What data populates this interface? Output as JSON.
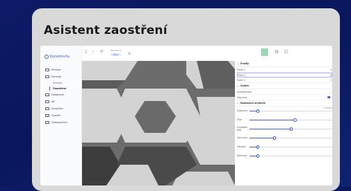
{
  "card": {
    "title": "Asistent zaostření"
  },
  "app": {
    "brand": "Konektivita",
    "sidebar": {
      "items": [
        {
          "label": "Přehled",
          "icon": "monitor-icon"
        },
        {
          "label": "Pohledy",
          "icon": "camera-icon"
        },
        {
          "label": "Nastavení",
          "icon": "gear-icon"
        },
        {
          "label": "Síť",
          "icon": "network-icon"
        },
        {
          "label": "Analytika",
          "icon": "chart-icon"
        },
        {
          "label": "Systém",
          "icon": "system-icon"
        },
        {
          "label": "Zabezpečení",
          "icon": "shield-icon"
        }
      ],
      "subitems": [
        {
          "label": "Snímek",
          "active": false
        },
        {
          "label": "Zaostření",
          "active": true
        }
      ]
    },
    "topbar": {
      "title": "Kamera 1",
      "status": "Živý"
    },
    "panel": {
      "sections": [
        {
          "title": "Profily",
          "rows": [
            {
              "label": "Profil 1",
              "value": ""
            },
            {
              "label": "Profil 2",
              "value": "",
              "highlight": true
            },
            {
              "label": "Profil 3",
              "value": ""
            }
          ]
        },
        {
          "title": "Světlo",
          "rows": [
            {
              "label": "Automaticky",
              "value": ""
            },
            {
              "label": "Zapnout",
              "value": "",
              "toggle": true
            }
          ]
        },
        {
          "title": "Nastavení snímače",
          "sliders": [
            {
              "label": "Expozice",
              "value": 0.1,
              "range_label": "1/20000"
            },
            {
              "label": "Zisk",
              "value": 0.55,
              "range_label": ""
            },
            {
              "label": "Vyvážení bílé",
              "value": 0.5,
              "range_label": ""
            },
            {
              "label": "Saturace",
              "value": 0.3,
              "range_label": ""
            },
            {
              "label": "Ostrost",
              "value": 0.1,
              "range_label": ""
            },
            {
              "label": "Kontrast",
              "value": 0.1,
              "range_label": ""
            }
          ]
        }
      ]
    }
  },
  "colors": {
    "accent": "#3f63c4",
    "status_green": "#37c76b",
    "image_bg": "#6c6c6c",
    "image_pattern_dark": "#5a5a5a",
    "image_pattern_light": "#d3d3d3"
  }
}
